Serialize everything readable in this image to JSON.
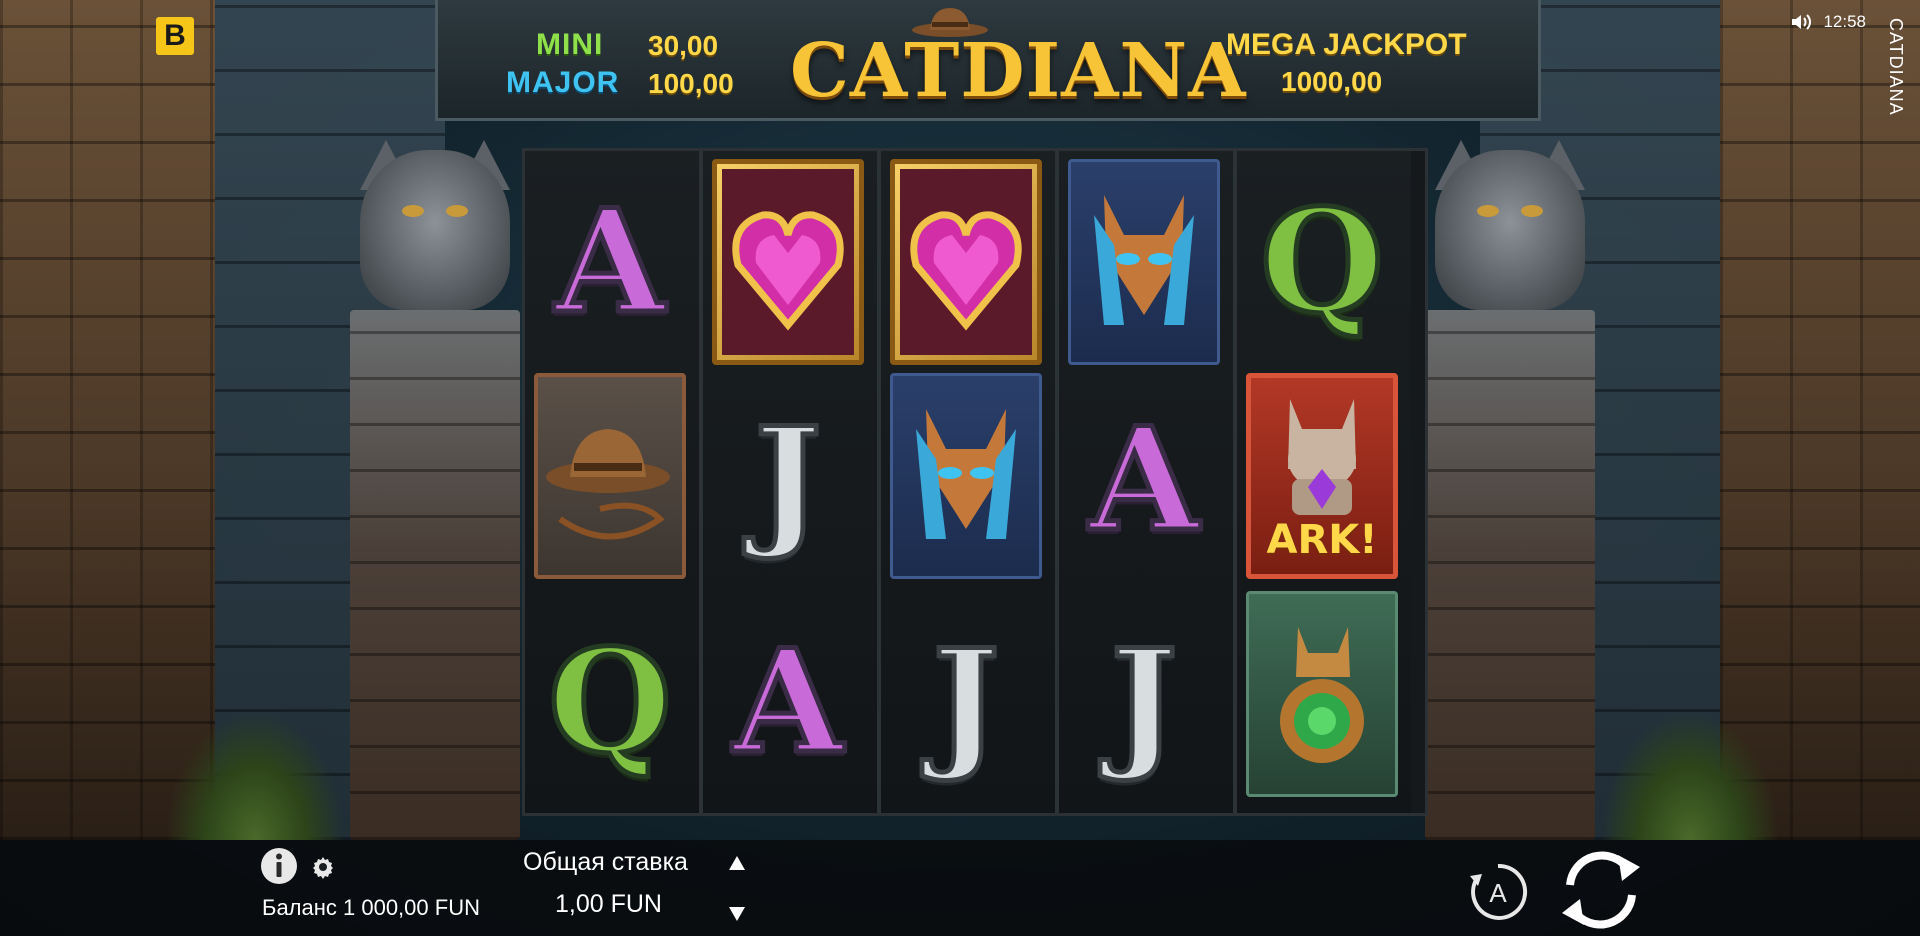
{
  "brand": {
    "logo_letter": "B"
  },
  "status": {
    "time": "12:58",
    "speaker_icon": "speaker-icon"
  },
  "side_title": "CATDIANA",
  "game": {
    "logo_text": "CATDIANA"
  },
  "jackpots": {
    "mini_label": "MINI",
    "mini_value": "30,00",
    "major_label": "MAJOR",
    "major_value": "100,00",
    "mega_label": "MEGA JACKPOT",
    "mega_value": "1000,00"
  },
  "reels": [
    [
      "A",
      "hat-whip",
      "Q"
    ],
    [
      "heart-gem",
      "J",
      "A"
    ],
    [
      "heart-gem",
      "cat-mask",
      "J"
    ],
    [
      "cat-mask",
      "A",
      "J"
    ],
    [
      "Q",
      "ark-cat-statue",
      "cat-amulet"
    ]
  ],
  "ark_text": "ARK!",
  "footer": {
    "balance": "Баланс 1 000,00 FUN",
    "bet_label": "Общая ставка",
    "bet_value": "1,00 FUN",
    "auto_letter": "A"
  },
  "colors": {
    "gold": "#f7c437",
    "mini": "#8fe04a",
    "major": "#3fc3f0",
    "letter_A": "#c86ad8",
    "letter_Q": "#7fbf42",
    "letter_J": "#d8dde0"
  }
}
